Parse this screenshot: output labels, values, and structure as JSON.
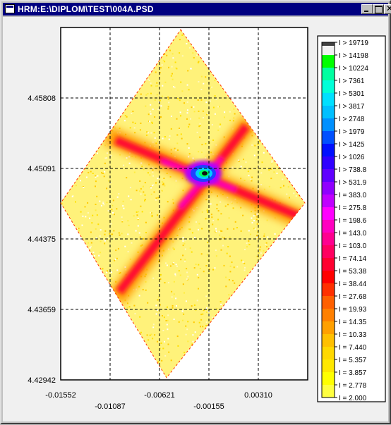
{
  "window": {
    "title": "HRM:E:\\DIPLOM\\TEST\\004A.PSD",
    "buttons": [
      "minimize-button",
      "maximize-button",
      "close-button"
    ]
  },
  "plot": {
    "background": "#ffffff",
    "frame": "#000000",
    "y_ticks": [
      "4.45808",
      "4.45091",
      "4.44375",
      "4.43659",
      "4.42942"
    ],
    "x_ticks_row1": [
      "-0.01552",
      "-0.00621",
      "0.00310"
    ],
    "x_ticks_row2": [
      "-0.01087",
      "-0.00155"
    ]
  },
  "legend": {
    "labels": [
      "I > 19719",
      "I > 14198",
      "I > 10224",
      "I > 7361",
      "I > 5301",
      "I > 3817",
      "I > 2748",
      "I > 1979",
      "I > 1425",
      "I > 1026",
      "I > 738.8",
      "I > 531.9",
      "I = 383.0",
      "I = 275.8",
      "I = 198.6",
      "I = 143.0",
      "I = 103.0",
      "I = 74.14",
      "I = 53.38",
      "I = 38.44",
      "I = 27.68",
      "I = 19.93",
      "I = 14.35",
      "I = 10.33",
      "I = 7.440",
      "I = 5.357",
      "I = 3.857",
      "I = 2.778",
      "I = 2.000"
    ],
    "colors": [
      "#f2f2f2",
      "#00ff00",
      "#00ffa0",
      "#00ffd8",
      "#00e0ff",
      "#00c0ff",
      "#0090ff",
      "#0050ff",
      "#0010ff",
      "#3000ff",
      "#6000ff",
      "#9000ff",
      "#c000ff",
      "#ff00ff",
      "#ff00c0",
      "#ff0090",
      "#ff0060",
      "#ff0030",
      "#ff0000",
      "#ff3000",
      "#ff6000",
      "#ff8000",
      "#ffa000",
      "#ffc000",
      "#ffd800",
      "#ffe800",
      "#ffff00",
      "#ffff40"
    ]
  }
}
